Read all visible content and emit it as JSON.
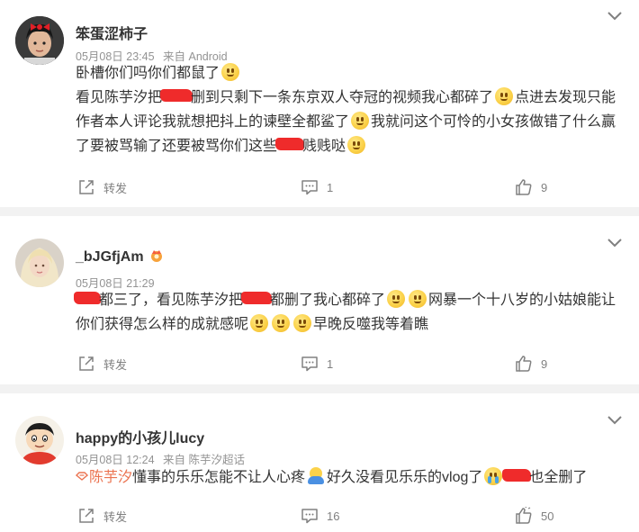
{
  "comments": [
    {
      "username": "笨蛋涩柿子",
      "date": "05月08日 23:45",
      "source": "来自 Android",
      "text": {
        "p1": "卧槽你们吗你们都鼠了",
        "p2": "看见陈芋汐把",
        "p3": "删到只剩下一条东京双人夺冠的视频我心都碎了",
        "p4": "点进去发现只能作者本人评论我就想把抖上的谏壁全都鲨了",
        "p5": "我就问这个可怜的小女孩做错了什么赢了要被骂输了还要被骂你们这些",
        "p6": "贱贱哒"
      },
      "repost_label": "转发",
      "comment_count": "1",
      "like_count": "9"
    },
    {
      "username": "_bJGfjAm",
      "date": "05月08日 21:29",
      "source": "",
      "text": {
        "p1": "都三了，看见陈芋汐把",
        "p2": "都删了我心都碎了",
        "p3": "网暴一个十八岁的小姑娘能让你们获得怎么样的成就感呢",
        "p4": "早晚反噬我等着瞧"
      },
      "repost_label": "转发",
      "comment_count": "1",
      "like_count": "9"
    },
    {
      "username": "happy的小孩儿lucy",
      "date": "05月08日 12:24",
      "source": "来自 陈芋汐超话",
      "text": {
        "tag": "陈芋汐",
        "p1": "懂事的乐乐怎能不让人心疼",
        "p2": "好久没看见乐乐的vlog了",
        "p3": "也全删了"
      },
      "repost_label": "转发",
      "comment_count": "16",
      "like_count": "50"
    }
  ],
  "icons": {
    "chevron": "chevron-down-icon",
    "repost": "share-icon",
    "comment": "comment-icon",
    "like": "thumbs-up-icon",
    "emoji": "smile-emoji",
    "vip": "vip-badge-icon"
  },
  "colors": {
    "accent_tag": "#eb7350",
    "meta_gray": "#939393",
    "redaction": "#ef2b2b",
    "separator": "#f2f2f2"
  }
}
